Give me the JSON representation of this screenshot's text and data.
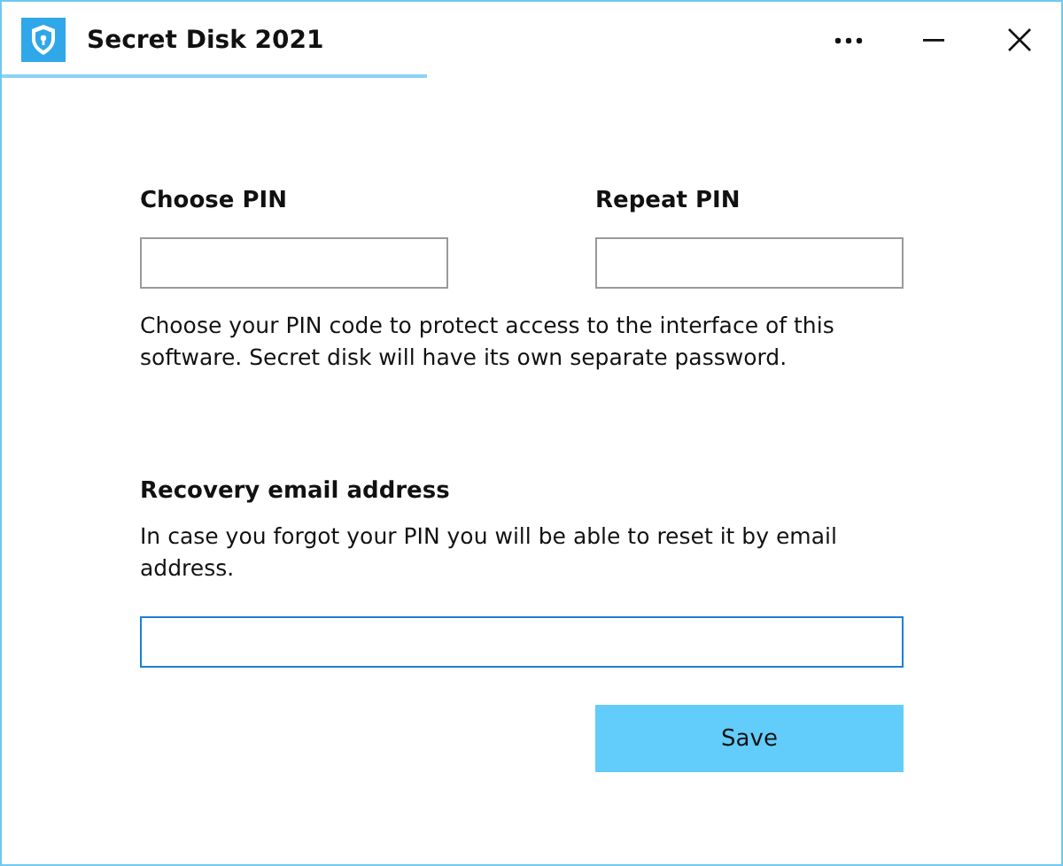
{
  "window": {
    "title": "Secret Disk 2021"
  },
  "pin_fields": [
    {
      "label": "Choose PIN",
      "focused": false
    },
    {
      "label": "Repeat PIN",
      "focused": false
    }
  ],
  "pin_hint": "Choose your PIN code to protect access to the interface of this software. Secret disk will have its own separate password.",
  "recovery": {
    "label": "Recovery email address",
    "hint": "In case you forgot your PIN you will be able to reset it by email address.",
    "focused": true
  },
  "buttons": [
    "Save"
  ]
}
